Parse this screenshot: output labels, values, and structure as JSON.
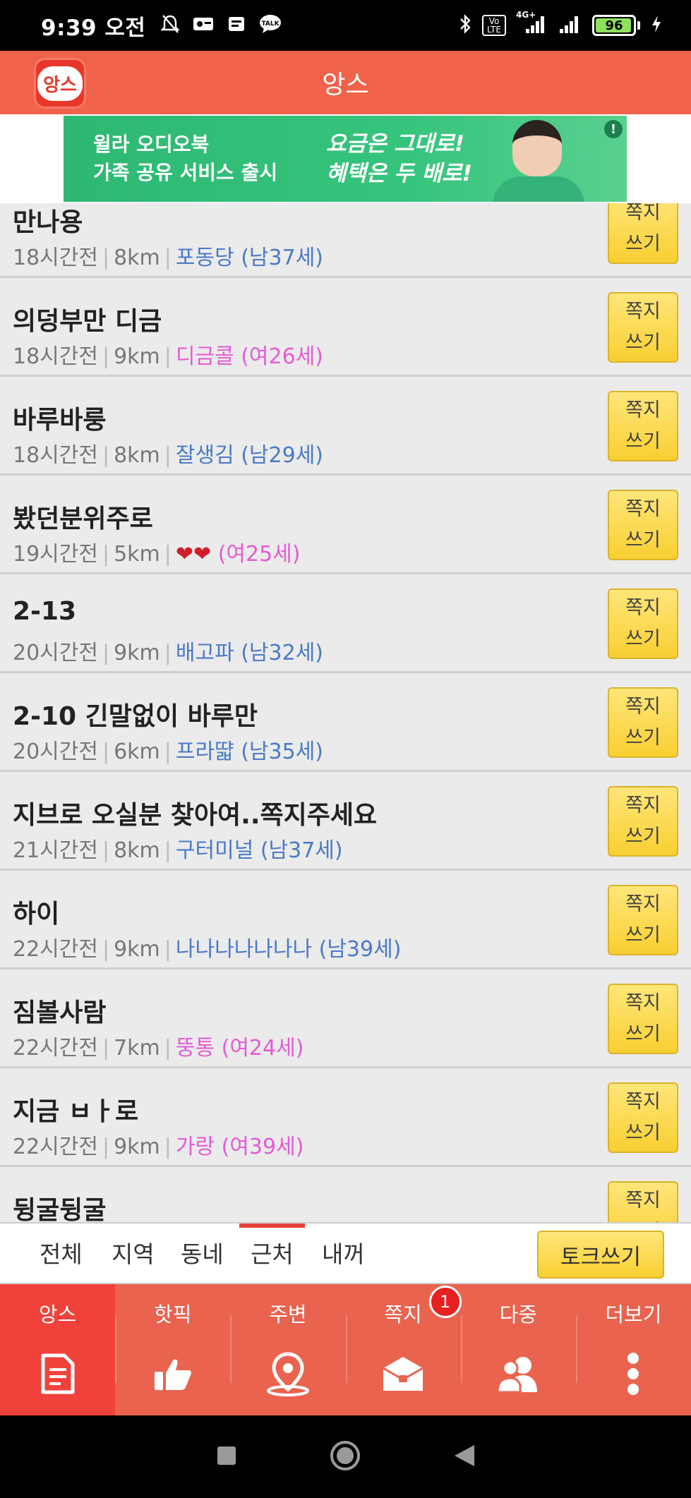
{
  "status_bar": {
    "time": "9:39 오전",
    "network_label": "4G+",
    "volte_label": "Vo LTE",
    "battery": "96",
    "battery_level": 0.96,
    "icons": [
      "bell-off-icon",
      "message-icon",
      "news-icon",
      "talk-icon",
      "bluetooth-icon",
      "signal-icon",
      "wifi-icon",
      "charging-icon"
    ]
  },
  "header": {
    "title": "앙스",
    "logo_text": "앙스"
  },
  "ad": {
    "line1": "윌라 오디오북",
    "line2": "가족 공유 서비스 출시",
    "line3": "요금은 그대로!",
    "line4": "혜택은 두 배로!",
    "badge": "!"
  },
  "posts": [
    {
      "title": "만나용",
      "time": "18시간전",
      "distance": "8km",
      "nick": "포동당 (남37세)",
      "gender": "m",
      "button": [
        "쪽지",
        "쓰기"
      ]
    },
    {
      "title": "의덩부만 디금",
      "time": "18시간전",
      "distance": "9km",
      "nick": "디금콜 (여26세)",
      "gender": "f",
      "button": [
        "쪽지",
        "쓰기"
      ]
    },
    {
      "title": "바루바룽",
      "time": "18시간전",
      "distance": "8km",
      "nick": "잘생김 (남29세)",
      "gender": "m",
      "button": [
        "쪽지",
        "쓰기"
      ]
    },
    {
      "title": "봤던분위주로",
      "time": "19시간전",
      "distance": "5km",
      "hearts": "❤❤",
      "nick": " (여25세)",
      "gender": "f",
      "button": [
        "쪽지",
        "쓰기"
      ]
    },
    {
      "title": "2-13",
      "time": "20시간전",
      "distance": "9km",
      "nick": "배고파 (남32세)",
      "gender": "m",
      "button": [
        "쪽지",
        "쓰기"
      ]
    },
    {
      "title": "2-10 긴말없이 바루만",
      "time": "20시간전",
      "distance": "6km",
      "nick": "프라땳 (남35세)",
      "gender": "m",
      "button": [
        "쪽지",
        "쓰기"
      ]
    },
    {
      "title": "지브로 오실분 찾아여..쪽지주세요",
      "time": "21시간전",
      "distance": "8km",
      "nick": "구터미널 (남37세)",
      "gender": "m",
      "button": [
        "쪽지",
        "쓰기"
      ]
    },
    {
      "title": "하이",
      "time": "22시간전",
      "distance": "9km",
      "nick": "나나나나나나나 (남39세)",
      "gender": "m",
      "button": [
        "쪽지",
        "쓰기"
      ]
    },
    {
      "title": "짐볼사람",
      "time": "22시간전",
      "distance": "7km",
      "nick": "뚱통 (여24세)",
      "gender": "f",
      "button": [
        "쪽지",
        "쓰기"
      ]
    },
    {
      "title": "지금 ㅂㅏ로",
      "time": "22시간전",
      "distance": "9km",
      "nick": "가랑 (여39세)",
      "gender": "f",
      "button": [
        "쪽지",
        "쓰기"
      ]
    },
    {
      "title": "뒹굴뒹굴",
      "time": "",
      "distance": "",
      "nick": "",
      "gender": "m",
      "button": [
        "쪽지",
        "쓰기"
      ]
    }
  ],
  "filter_tabs": [
    "전체",
    "지역",
    "동네",
    "근처",
    "내꺼"
  ],
  "filter_active": "근처",
  "write_button": "토크쓰기",
  "bottom_nav": [
    {
      "label": "앙스",
      "icon": "document-icon",
      "active": true
    },
    {
      "label": "핫픽",
      "icon": "thumbs-up-icon"
    },
    {
      "label": "주변",
      "icon": "location-pin-icon"
    },
    {
      "label": "쪽지",
      "icon": "envelope-icon",
      "badge": "1"
    },
    {
      "label": "다중",
      "icon": "group-icon"
    },
    {
      "label": "더보기",
      "icon": "more-vertical-icon"
    }
  ],
  "system_nav": [
    "recents-icon",
    "home-icon",
    "back-icon"
  ]
}
